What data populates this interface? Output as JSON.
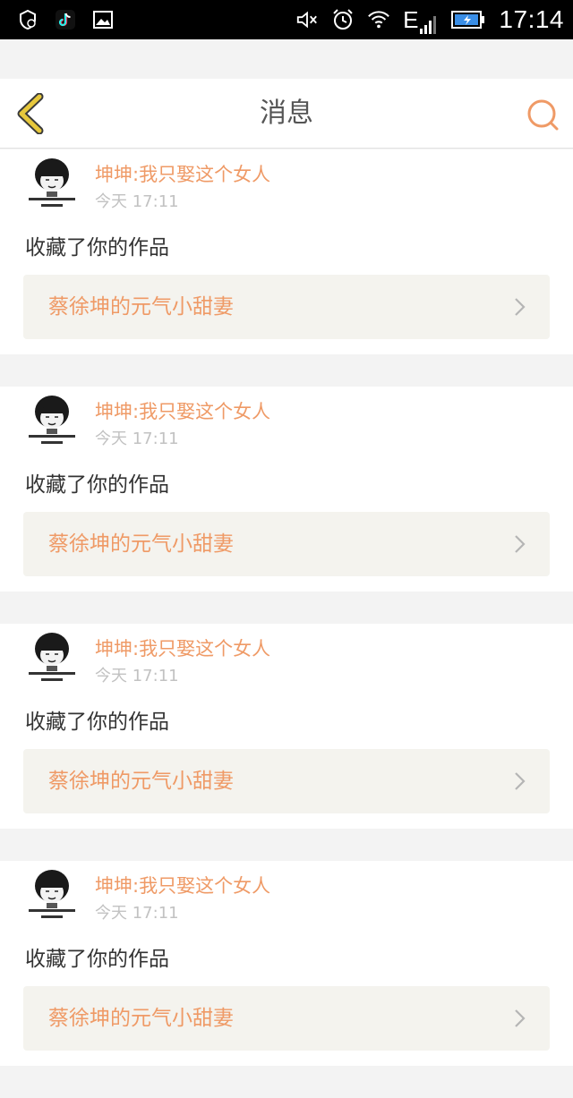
{
  "status_bar": {
    "time": "17:14",
    "carrier": "E",
    "left_icons": [
      "shield-icon",
      "tiktok-icon",
      "image-icon"
    ],
    "right_icons": [
      "mute-icon",
      "alarm-icon",
      "wifi-icon",
      "signal-icon",
      "battery-charging-icon"
    ]
  },
  "nav": {
    "title": "消息",
    "back_icon": "back-chevron-icon",
    "search_icon": "search-icon"
  },
  "colors": {
    "accent": "#ef9a66",
    "back_icon": "#e7c83c",
    "card_link_bg": "#f4f3ee",
    "background": "#f3f3f3"
  },
  "messages": [
    {
      "user": "坤坤:我只娶这个女人",
      "time": "今天 17:11",
      "action": "收藏了你的作品",
      "work": "蔡徐坤的元气小甜妻"
    },
    {
      "user": "坤坤:我只娶这个女人",
      "time": "今天 17:11",
      "action": "收藏了你的作品",
      "work": "蔡徐坤的元气小甜妻"
    },
    {
      "user": "坤坤:我只娶这个女人",
      "time": "今天 17:11",
      "action": "收藏了你的作品",
      "work": "蔡徐坤的元气小甜妻"
    },
    {
      "user": "坤坤:我只娶这个女人",
      "time": "今天 17:11",
      "action": "收藏了你的作品",
      "work": "蔡徐坤的元气小甜妻"
    }
  ]
}
